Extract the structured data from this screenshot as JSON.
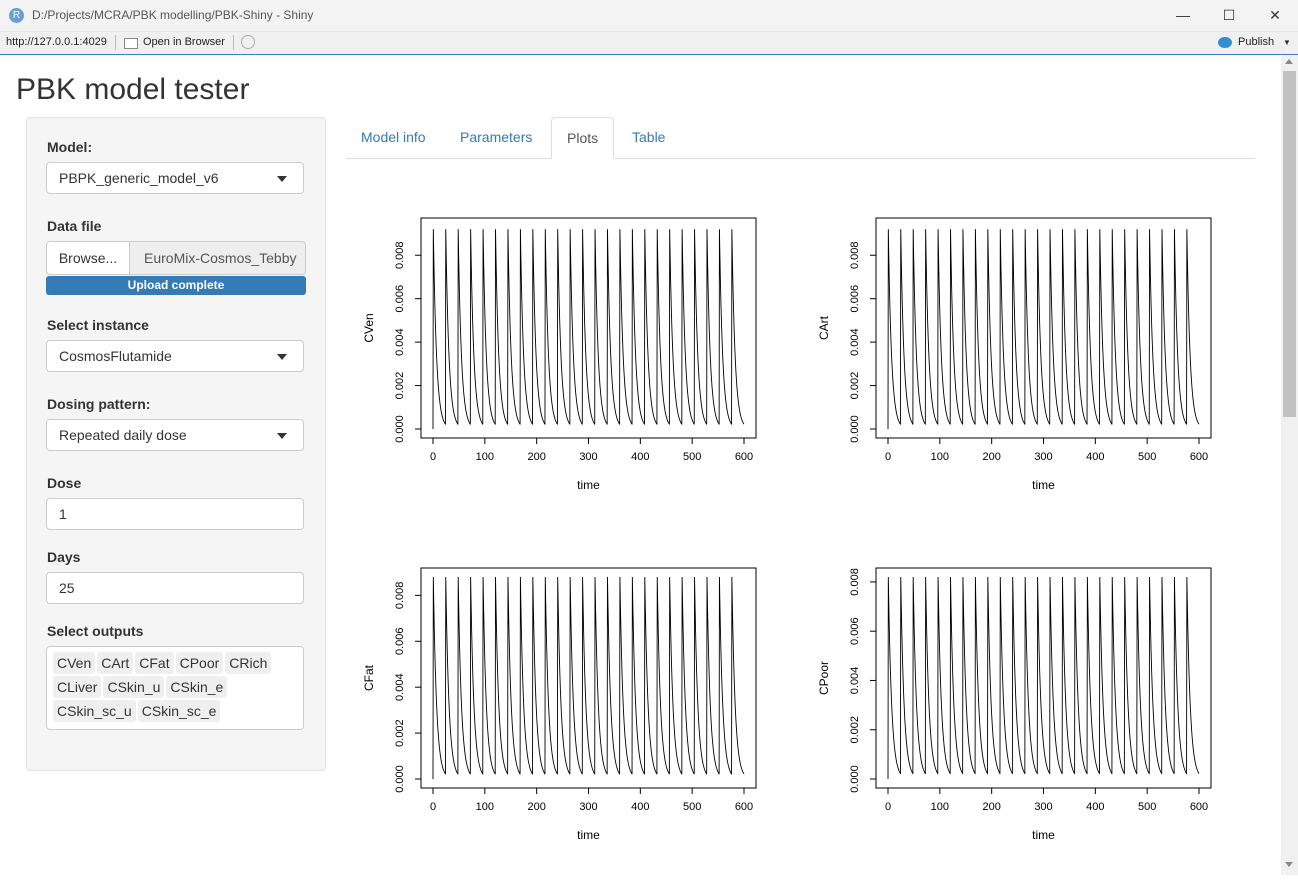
{
  "window": {
    "title": "D:/Projects/MCRA/PBK modelling/PBK-Shiny - Shiny",
    "app_icon": "R",
    "minimize": "—",
    "maximize": "☐",
    "close": "✕"
  },
  "address_bar": {
    "url": "http://127.0.0.1:4029",
    "open_in_browser": "Open in Browser",
    "publish": "Publish"
  },
  "page": {
    "title": "PBK model tester"
  },
  "sidebar": {
    "model": {
      "label": "Model:",
      "value": "PBPK_generic_model_v6"
    },
    "data_file": {
      "label": "Data file",
      "browse": "Browse...",
      "filename": "EuroMix-Cosmos_Tebby",
      "progress": "Upload complete"
    },
    "instance": {
      "label": "Select instance",
      "value": "CosmosFlutamide"
    },
    "dosing": {
      "label": "Dosing pattern:",
      "value": "Repeated daily dose"
    },
    "dose": {
      "label": "Dose",
      "value": "1"
    },
    "days": {
      "label": "Days",
      "value": "25"
    },
    "outputs": {
      "label": "Select outputs",
      "items": [
        "CVen",
        "CArt",
        "CFat",
        "CPoor",
        "CRich",
        "CLiver",
        "CSkin_u",
        "CSkin_e",
        "CSkin_sc_u",
        "CSkin_sc_e"
      ]
    }
  },
  "tabs": [
    {
      "label": "Model info",
      "active": false
    },
    {
      "label": "Parameters",
      "active": false
    },
    {
      "label": "Plots",
      "active": true
    },
    {
      "label": "Table",
      "active": false
    }
  ],
  "chart_data": [
    {
      "type": "line",
      "xlabel": "time",
      "ylabel": "CVen",
      "xlim": [
        0,
        600
      ],
      "ylim": [
        0,
        0.0093
      ],
      "xticks": [
        "0",
        "100",
        "200",
        "300",
        "400",
        "500",
        "600"
      ],
      "yticks": [
        "0.000",
        "0.002",
        "0.004",
        "0.006",
        "0.008"
      ],
      "pattern": {
        "doses": 25,
        "interval": 24,
        "peak": 0.0092,
        "trough": 0.0002
      }
    },
    {
      "type": "line",
      "xlabel": "time",
      "ylabel": "CArt",
      "xlim": [
        0,
        600
      ],
      "ylim": [
        0,
        0.0093
      ],
      "xticks": [
        "0",
        "100",
        "200",
        "300",
        "400",
        "500",
        "600"
      ],
      "yticks": [
        "0.000",
        "0.002",
        "0.004",
        "0.006",
        "0.008"
      ],
      "pattern": {
        "doses": 25,
        "interval": 24,
        "peak": 0.0092,
        "trough": 0.0002
      }
    },
    {
      "type": "line",
      "xlabel": "time",
      "ylabel": "CFat",
      "xlim": [
        0,
        600
      ],
      "ylim": [
        0,
        0.0088
      ],
      "xticks": [
        "0",
        "100",
        "200",
        "300",
        "400",
        "500",
        "600"
      ],
      "yticks": [
        "0.000",
        "0.002",
        "0.004",
        "0.006",
        "0.008"
      ],
      "pattern": {
        "doses": 25,
        "interval": 24,
        "peak": 0.0088,
        "trough": 0.0002
      }
    },
    {
      "type": "line",
      "xlabel": "time",
      "ylabel": "CPoor",
      "xlim": [
        0,
        600
      ],
      "ylim": [
        0,
        0.0082
      ],
      "xticks": [
        "0",
        "100",
        "200",
        "300",
        "400",
        "500",
        "600"
      ],
      "yticks": [
        "0.000",
        "0.002",
        "0.004",
        "0.006",
        "0.008"
      ],
      "pattern": {
        "doses": 25,
        "interval": 24,
        "peak": 0.0082,
        "trough": 0.0002
      }
    }
  ]
}
